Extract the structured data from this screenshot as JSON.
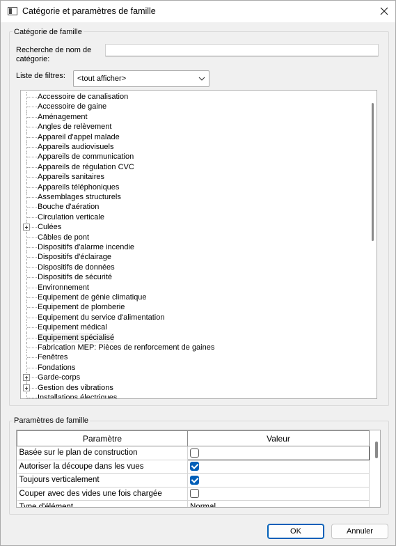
{
  "window": {
    "title": "Catégorie et paramètres de famille",
    "close_symbol": "✕"
  },
  "category_group": {
    "legend": "Catégorie de famille",
    "search_label_line1": "Recherche de nom de",
    "search_label_line2": "catégorie:",
    "search_value": "",
    "filter_label": "Liste de filtres:",
    "filter_selected": "<tout afficher>"
  },
  "tree": {
    "items": [
      {
        "label": "Accessoire de canalisation",
        "expandable": false
      },
      {
        "label": "Accessoire de gaine",
        "expandable": false
      },
      {
        "label": "Aménagement",
        "expandable": false
      },
      {
        "label": "Angles de relèvement",
        "expandable": false
      },
      {
        "label": "Appareil d'appel malade",
        "expandable": false
      },
      {
        "label": "Appareils audiovisuels",
        "expandable": false
      },
      {
        "label": "Appareils de communication",
        "expandable": false
      },
      {
        "label": "Appareils de régulation CVC",
        "expandable": false
      },
      {
        "label": "Appareils sanitaires",
        "expandable": false
      },
      {
        "label": "Appareils téléphoniques",
        "expandable": false
      },
      {
        "label": "Assemblages structurels",
        "expandable": false
      },
      {
        "label": "Bouche d'aération",
        "expandable": false
      },
      {
        "label": "Circulation verticale",
        "expandable": false
      },
      {
        "label": "Culées",
        "expandable": true
      },
      {
        "label": "Câbles de pont",
        "expandable": false
      },
      {
        "label": "Dispositifs d'alarme incendie",
        "expandable": false
      },
      {
        "label": "Dispositifs d'éclairage",
        "expandable": false
      },
      {
        "label": "Dispositifs de données",
        "expandable": false
      },
      {
        "label": "Dispositifs de sécurité",
        "expandable": false
      },
      {
        "label": "Environnement",
        "expandable": false
      },
      {
        "label": "Equipement de génie climatique",
        "expandable": false
      },
      {
        "label": "Equipement de plomberie",
        "expandable": false
      },
      {
        "label": "Equipement du service d'alimentation",
        "expandable": false
      },
      {
        "label": "Equipement médical",
        "expandable": false
      },
      {
        "label": "Equipement spécialisé",
        "expandable": false
      },
      {
        "label": "Fabrication MEP: Pièces de renforcement de gaines",
        "expandable": false
      },
      {
        "label": "Fenêtres",
        "expandable": false
      },
      {
        "label": "Fondations",
        "expandable": false
      },
      {
        "label": "Garde-corps",
        "expandable": true
      },
      {
        "label": "Gestion des vibrations",
        "expandable": true
      },
      {
        "label": "Installations électriques",
        "expandable": false
      }
    ],
    "hovered_index": 24
  },
  "params_group": {
    "legend": "Paramètres de famille",
    "col_param": "Paramètre",
    "col_value": "Valeur",
    "rows": [
      {
        "name": "Basée sur le plan de construction",
        "type": "checkbox",
        "checked": false,
        "selected": true
      },
      {
        "name": "Autoriser la découpe dans les vues",
        "type": "checkbox",
        "checked": true,
        "selected": false
      },
      {
        "name": "Toujours verticalement",
        "type": "checkbox",
        "checked": true,
        "selected": false
      },
      {
        "name": "Couper avec des vides une fois chargée",
        "type": "checkbox",
        "checked": false,
        "selected": false
      },
      {
        "name": "Type d'élément",
        "type": "text",
        "value": "Normal",
        "selected": false
      }
    ]
  },
  "buttons": {
    "ok": "OK",
    "cancel": "Annuler"
  },
  "colors": {
    "accent": "#005fb8",
    "dialog_bg": "#f0f0f0"
  }
}
